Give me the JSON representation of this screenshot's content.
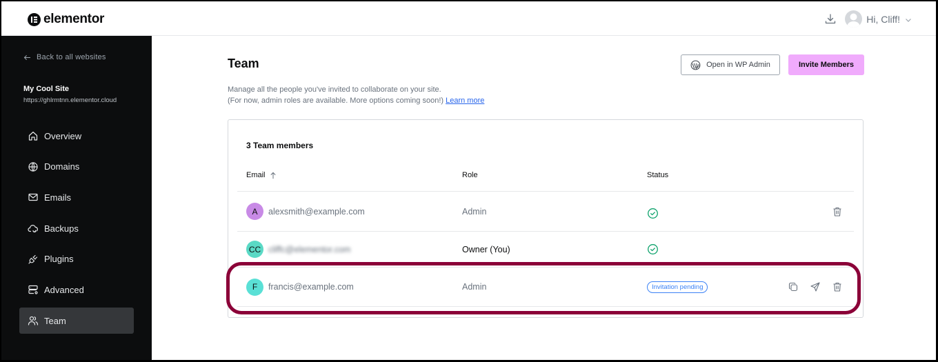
{
  "topbar": {
    "logo_text": "elementor",
    "greeting": "Hi, Cliff!",
    "icons": {
      "download": "download-icon",
      "avatar": "user-avatar",
      "caret": "chevron-down-icon"
    }
  },
  "sidebar": {
    "back_label": "Back to all websites",
    "site_name": "My Cool Site",
    "site_url": "https://ghlrmtnn.elementor.cloud",
    "items": [
      {
        "label": "Overview",
        "icon": "home-icon",
        "active": false
      },
      {
        "label": "Domains",
        "icon": "globe-icon",
        "active": false
      },
      {
        "label": "Emails",
        "icon": "mail-icon",
        "active": false
      },
      {
        "label": "Backups",
        "icon": "cloud-icon",
        "active": false
      },
      {
        "label": "Plugins",
        "icon": "plug-icon",
        "active": false
      },
      {
        "label": "Advanced",
        "icon": "server-icon",
        "active": false
      },
      {
        "label": "Team",
        "icon": "users-icon",
        "active": true
      }
    ]
  },
  "main": {
    "title": "Team",
    "description_line1": "Manage all the people you've invited to collaborate on your site.",
    "description_line2": "(For now, admin roles are available. More options coming soon!)",
    "learn_more": "Learn more",
    "open_wp_admin": "Open in WP Admin",
    "invite_members": "Invite Members",
    "table": {
      "count_label": "3 Team members",
      "columns": {
        "email": "Email",
        "role": "Role",
        "status": "Status"
      },
      "sort": {
        "column": "email",
        "direction": "ascending"
      },
      "rows": [
        {
          "initials": "A",
          "avatar_color": "#c88ae6",
          "email": "alexsmith@example.com",
          "role": "Admin",
          "status": "active",
          "actions": [
            "delete"
          ]
        },
        {
          "initials": "CC",
          "avatar_color": "#5ad9c5",
          "email": "cliffc@elementor.com",
          "email_blurred": true,
          "role": "Owner (You)",
          "status": "active",
          "actions": []
        },
        {
          "initials": "F",
          "avatar_color": "#5ae0d6",
          "email": "francis@example.com",
          "role": "Admin",
          "status": "Invitation pending",
          "actions": [
            "copy",
            "resend",
            "delete"
          ]
        }
      ]
    }
  },
  "colors": {
    "sidebar_bg": "#0c0d0e",
    "active_nav_bg": "#35373a",
    "invite_button": "#f0abfc",
    "status_ok": "#10a36d",
    "pending_badge": "#3b82f6",
    "highlight": "#8b0038",
    "link": "#2563eb"
  }
}
